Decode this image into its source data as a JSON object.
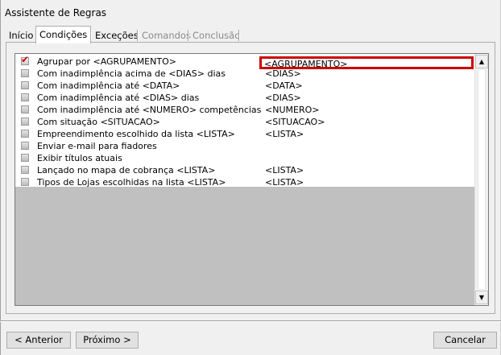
{
  "window": {
    "title": "Assistente de Regras"
  },
  "tabs": [
    {
      "label": "Início",
      "state": "normal"
    },
    {
      "label": "Condições",
      "state": "active"
    },
    {
      "label": "Exceções",
      "state": "normal"
    },
    {
      "label": "Comandos",
      "state": "disabled"
    },
    {
      "label": "Conclusão",
      "state": "disabled"
    }
  ],
  "conditions": [
    {
      "label": "Agrupar por <AGRUPAMENTO>",
      "value": "<AGRUPAMENTO>",
      "checked": true,
      "editing": true
    },
    {
      "label": "Com inadimplência acima de <DIAS> dias",
      "value": "<DIAS>",
      "checked": false
    },
    {
      "label": "Com inadimplência até <DATA>",
      "value": "<DATA>",
      "checked": false
    },
    {
      "label": "Com inadimplência até <DIAS>  dias",
      "value": "<DIAS>",
      "checked": false
    },
    {
      "label": "Com inadimplência até <NUMERO> competências",
      "value": "<NUMERO>",
      "checked": false
    },
    {
      "label": "Com situação <SITUACAO>",
      "value": "<SITUACAO>",
      "checked": false
    },
    {
      "label": "Empreendimento escolhido da lista <LISTA>",
      "value": "<LISTA>",
      "checked": false
    },
    {
      "label": "Enviar e-mail para fiadores",
      "value": "",
      "checked": false
    },
    {
      "label": "Exibir títulos atuais",
      "value": "",
      "checked": false
    },
    {
      "label": "Lançado no mapa de cobrança <LISTA>",
      "value": "<LISTA>",
      "checked": false
    },
    {
      "label": "Tipos de Lojas escolhidas na lista <LISTA>",
      "value": "<LISTA>",
      "checked": false
    }
  ],
  "buttons": {
    "back": "< Anterior",
    "next": "Próximo >",
    "cancel": "Cancelar"
  },
  "colors": {
    "highlight_border": "#cc0000",
    "check_mark": "#cc0000"
  },
  "icons": {
    "check": "check-mark-icon",
    "scroll_up": "arrow-up-icon",
    "scroll_down": "arrow-down-icon"
  }
}
